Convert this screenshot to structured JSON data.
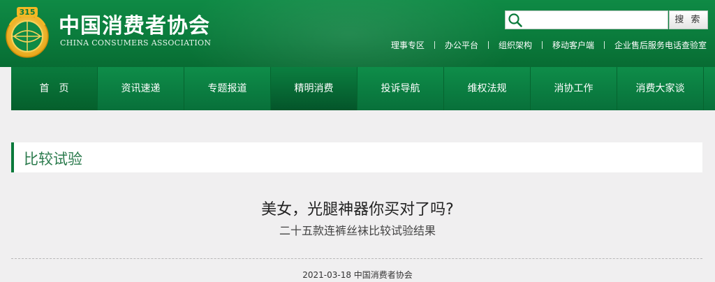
{
  "header": {
    "site_name_cn": "中国消费者协会",
    "site_name_en": "CHINA CONSUMERS ASSOCIATION",
    "logo_icon": "cca-315-logo-icon",
    "search": {
      "placeholder": "",
      "button_label": "搜 索",
      "icon": "search-icon"
    },
    "top_links": [
      "理事专区",
      "办公平台",
      "组织架构",
      "移动客户端",
      "企业售后服务电话查验室"
    ]
  },
  "nav": {
    "items": [
      "首　页",
      "资讯速递",
      "专题报道",
      "精明消费",
      "投诉导航",
      "维权法规",
      "消协工作",
      "消费大家谈"
    ]
  },
  "section": {
    "title": "比较试验"
  },
  "article": {
    "title": "美女，光腿神器你买对了吗?",
    "subtitle": "二十五款连裤丝袜比较试验结果",
    "meta": "2021-03-18 中国消费者协会"
  },
  "colors": {
    "brand_green": "#0a7a3b",
    "logo_gold": "#f2b824",
    "section_text": "#2a7a4c",
    "page_bg": "#f0eff0"
  }
}
